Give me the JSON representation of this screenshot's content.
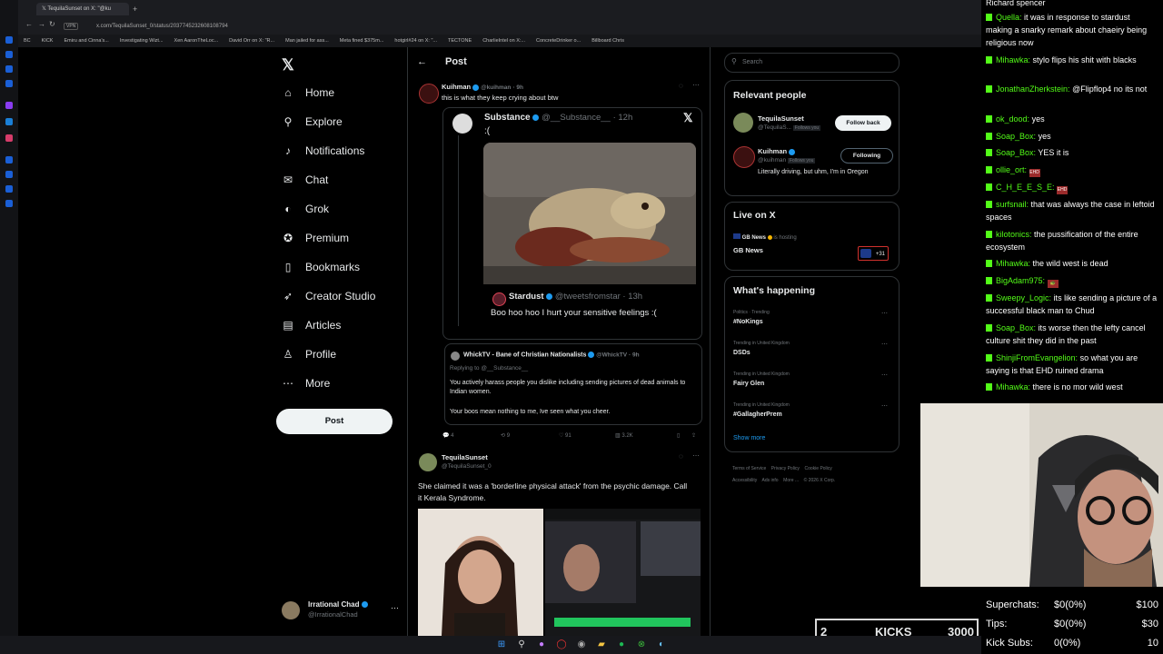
{
  "browser": {
    "tabs": [
      {
        "label": "TequilaSunset on X: \"@ku"
      }
    ],
    "url": "x.com/TequilaSunset_0/status/2037745232608108794",
    "vpn_label": "VPN",
    "bookmarks": [
      "BC",
      "KICK",
      "Emiru and Cinna's...",
      "Investigating Wizt...",
      "Xen AaronTheLoc...",
      "David Orr on X: \"R...",
      "Man jailed for ass...",
      "Meta fined $375m...",
      "hotgirl#24 on X: \"...",
      "TECTONE",
      "CharlieIntel on X:...",
      "ConcreteDrinker o...",
      "Billboard Chris"
    ]
  },
  "nav": {
    "items": [
      {
        "label": "Home",
        "icon": "home-icon",
        "glyph": "⌂"
      },
      {
        "label": "Explore",
        "icon": "search-icon",
        "glyph": "⚲"
      },
      {
        "label": "Notifications",
        "icon": "bell-icon",
        "glyph": "♪"
      },
      {
        "label": "Chat",
        "icon": "mail-icon",
        "glyph": "✉"
      },
      {
        "label": "Grok",
        "icon": "grok-icon",
        "glyph": "◐"
      },
      {
        "label": "Premium",
        "icon": "premium-icon",
        "glyph": "✪"
      },
      {
        "label": "Bookmarks",
        "icon": "bookmark-icon",
        "glyph": "▯"
      },
      {
        "label": "Creator Studio",
        "icon": "rocket-icon",
        "glyph": "➶"
      },
      {
        "label": "Articles",
        "icon": "articles-icon",
        "glyph": "▤"
      },
      {
        "label": "Profile",
        "icon": "person-icon",
        "glyph": "♙"
      },
      {
        "label": "More",
        "icon": "more-icon",
        "glyph": "⋯"
      }
    ],
    "post_button": "Post",
    "account": {
      "name": "Irrational Chad",
      "handle": "@IrrationalChad"
    }
  },
  "post": {
    "header_title": "Post",
    "main": {
      "name": "Kuihman",
      "handle": "@kuihman",
      "time": "· 9h",
      "text": "this is what they keep crying about btw"
    },
    "quote": {
      "name": "Substance",
      "handle": "@__Substance__",
      "time": "· 12h",
      "text": ":(",
      "image_alt": "photo of a dead cow",
      "reply": {
        "name": "Stardust",
        "handle": "@tweetsfromstar",
        "time": "· 13h",
        "text": "Boo hoo hoo I hurt your sensitive feelings :("
      }
    },
    "embedded": {
      "name": "WhickTV - Bane of Christian Nationalists",
      "handle": "@WhickTV",
      "time": "· 9h",
      "replying": "Replying to @__Substance__",
      "text1": "You actively harass people you dislike including sending pictures of dead animals to Indian women.",
      "text2": "Your boos mean nothing to me, Ive seen what you cheer."
    },
    "actions": {
      "replies": "4",
      "reposts": "9",
      "likes": "91",
      "views": "3.2K"
    },
    "reply": {
      "name": "TequilaSunset",
      "handle": "@TequilaSunset_0",
      "text": "She claimed it was a 'borderline physical attack' from the psychic damage. Call it Kerala Syndrome."
    }
  },
  "right": {
    "search_placeholder": "Search",
    "relevant_title": "Relevant people",
    "people": [
      {
        "name": "TequilaSunset",
        "handle": "@TequilaS...",
        "follows_you": "Follows you",
        "button": "Follow back"
      },
      {
        "name": "Kuihman",
        "handle": "@kuihman",
        "follows_you": "Follows you",
        "button": "Following",
        "bio": "Literally driving, but uhm, I'm in Oregon"
      }
    ],
    "live_title": "Live on X",
    "live_host": "GB News",
    "live_host_suffix": "is hosting",
    "live_name": "GB News",
    "live_count": "+31",
    "happening_title": "What's happening",
    "trends": [
      {
        "category": "Politics · Trending",
        "name": "#NoKings"
      },
      {
        "category": "Trending in United Kingdom",
        "name": "DSDs"
      },
      {
        "category": "Trending in United Kingdom",
        "name": "Fairy Glen"
      },
      {
        "category": "Trending in United Kingdom",
        "name": "#GallagherPrem"
      }
    ],
    "show_more": "Show more",
    "footer": {
      "terms": "Terms of Service",
      "privacy": "Privacy Policy",
      "cookies": "Cookie Policy",
      "accessibility": "Accessibility",
      "ads": "Ads info",
      "more": "More ...",
      "copyright": "© 2026 X Corp."
    }
  },
  "chat": {
    "top_cut": "Richard spencer",
    "messages": [
      {
        "user": "Quella:",
        "text": "it was in response to stardust making a snarky remark about chaeiry being religious now"
      },
      {
        "user": "Mihawka:",
        "text": "stylo flips his shit with blacks"
      },
      {
        "user": "JonathanZherkstein:",
        "text": "@Flipflop4 no its not"
      },
      {
        "user": "ok_dood:",
        "text": "yes"
      },
      {
        "user": "Soap_Box:",
        "text": "yes"
      },
      {
        "user": "Soap_Box:",
        "text": "YES it is"
      },
      {
        "user": "ollie_ort:",
        "text": "",
        "emote": "EHD"
      },
      {
        "user": "C_H_E_E_S_E:",
        "text": "",
        "emote": "EHD"
      },
      {
        "user": "surfsnail:",
        "text": "that was always the case in leftoid spaces"
      },
      {
        "user": "kilotonics:",
        "text": "the pussification of the entire ecosystem"
      },
      {
        "user": "Mihawka:",
        "text": "the wild west is dead"
      },
      {
        "user": "BigAdam975:",
        "text": "",
        "emote": "🐢"
      },
      {
        "user": "Sweepy_Logic:",
        "text": "its like sending a picture of a successful black man to Chud"
      },
      {
        "user": "Soap_Box:",
        "text": "its worse then the lefty cancel culture shit they did in the past"
      },
      {
        "user": "ShinjiFromEvangelion:",
        "text": "so what you are saying is that EHD ruined drama"
      },
      {
        "user": "Mihawka:",
        "text": "there is no mor wild west"
      }
    ]
  },
  "stats": {
    "rows": [
      {
        "label": "Superchats:",
        "value": "$0(0%)",
        "goal": "$100"
      },
      {
        "label": "Tips:",
        "value": "$0(0%)",
        "goal": "$30"
      },
      {
        "label": "Kick Subs:",
        "value": "0(0%)",
        "goal": "10"
      }
    ],
    "kicks_count": "2",
    "kicks_label": "KICKS",
    "kicks_goal": "3000"
  },
  "colors": {
    "accent": "#1d9bf0",
    "kick_green": "#53fc18",
    "background": "#000000"
  }
}
